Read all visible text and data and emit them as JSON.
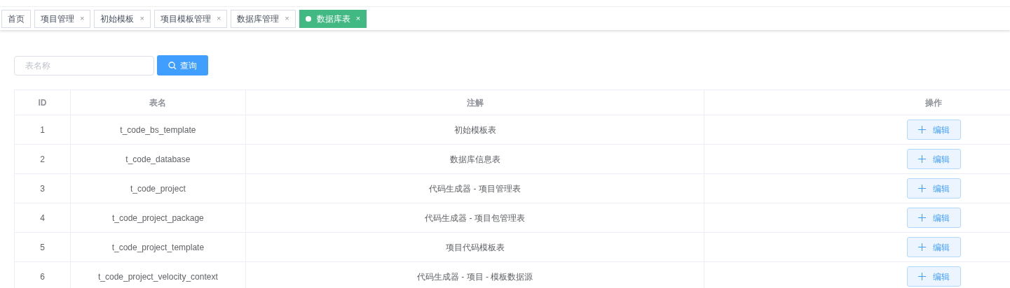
{
  "tabs": [
    {
      "label": "首页",
      "closable": false,
      "selected": false
    },
    {
      "label": "项目管理",
      "closable": true,
      "selected": false
    },
    {
      "label": "初始模板",
      "closable": true,
      "selected": false
    },
    {
      "label": "项目模板管理",
      "closable": true,
      "selected": false
    },
    {
      "label": "数据库管理",
      "closable": true,
      "selected": false
    },
    {
      "label": "数据库表",
      "closable": true,
      "selected": true
    }
  ],
  "close_glyph": "×",
  "search": {
    "placeholder": "表名称",
    "button": "查询"
  },
  "table": {
    "columns": [
      "ID",
      "表名",
      "注解",
      "操作"
    ],
    "rows": [
      {
        "id": "1",
        "name": "t_code_bs_template",
        "comment": "初始模板表",
        "action": "编辑"
      },
      {
        "id": "2",
        "name": "t_code_database",
        "comment": "数据库信息表",
        "action": "编辑"
      },
      {
        "id": "3",
        "name": "t_code_project",
        "comment": "代码生成器 - 项目管理表",
        "action": "编辑"
      },
      {
        "id": "4",
        "name": "t_code_project_package",
        "comment": "代码生成器 - 项目包管理表",
        "action": "编辑"
      },
      {
        "id": "5",
        "name": "t_code_project_template",
        "comment": "项目代码模板表",
        "action": "编辑"
      },
      {
        "id": "6",
        "name": "t_code_project_velocity_context",
        "comment": "代码生成器 - 项目 - 模板数据源",
        "action": "编辑"
      }
    ]
  }
}
